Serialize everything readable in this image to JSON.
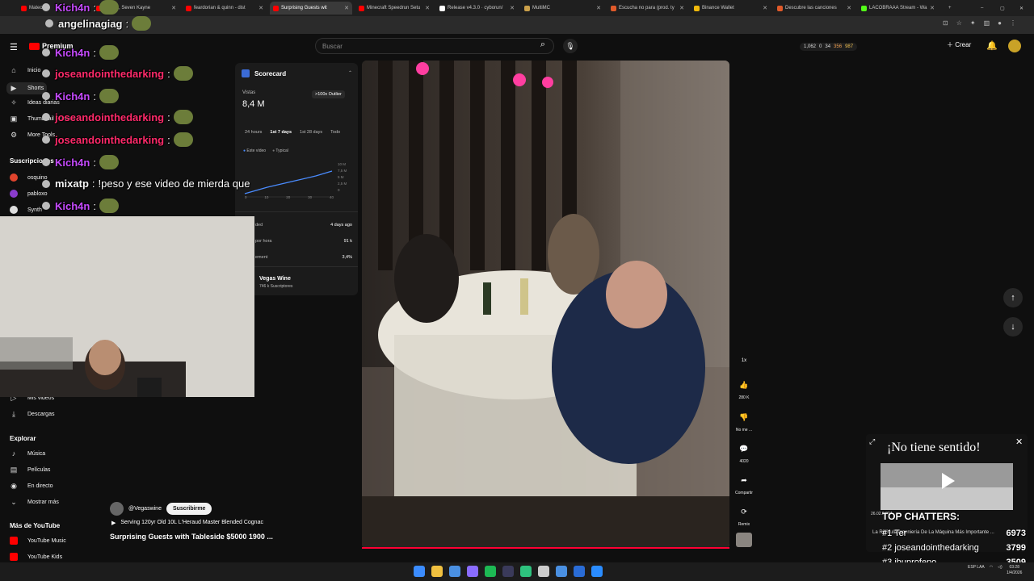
{
  "browser": {
    "tabs": [
      {
        "label": "Mateo",
        "color": "#ff0000"
      },
      {
        "label": "Kiske2, Seven Kayne",
        "color": "#ff0000"
      },
      {
        "label": "feardorian & quinn - dist",
        "color": "#ff0000"
      },
      {
        "label": "Surprising Guests wit",
        "color": "#ff0000",
        "active": true
      },
      {
        "label": "Minecraft Speedrun Setu",
        "color": "#ff0000"
      },
      {
        "label": "Release v4.3.0 · cyborun/",
        "color": "#ffffff"
      },
      {
        "label": "MultiMC",
        "color": "#caa04a"
      },
      {
        "label": "Escucha no para (prod. ty",
        "color": "#e05a2a"
      },
      {
        "label": "Binance Wallet",
        "color": "#f0b90b"
      },
      {
        "label": "Descubre las canciones",
        "color": "#e05a2a"
      },
      {
        "label": "LACOBRAAA Stream - Wa",
        "color": "#53fc18"
      }
    ],
    "new_tab": "+",
    "window_controls": [
      "–",
      "▢",
      "✕"
    ]
  },
  "header": {
    "logo_text": "Premium",
    "search_placeholder": "Buscar",
    "stats": [
      "1,062",
      "0",
      "34",
      "356",
      "987"
    ],
    "create_label": "Crear"
  },
  "sidebar": {
    "top_items": [
      {
        "label": "Inicio",
        "icon": "home-icon"
      },
      {
        "label": "Shorts",
        "icon": "shorts-icon"
      },
      {
        "label": "Ideas diarias",
        "icon": "ideas-icon"
      },
      {
        "label": "Thumbnail Preview",
        "icon": "thumbnail-icon"
      },
      {
        "label": "More Tools",
        "icon": "tools-icon"
      }
    ],
    "subscriptions_heading": "Suscripciones",
    "subscriptions": [
      {
        "label": "osquino",
        "color": "#e0442d"
      },
      {
        "label": "pabloxo",
        "color": "#8a3ccc"
      },
      {
        "label": "Synth",
        "color": "#dddddd"
      }
    ],
    "library_items": [
      {
        "label": "Mis videos",
        "icon": "videos-icon"
      },
      {
        "label": "Descargas",
        "icon": "download-icon"
      }
    ],
    "explore_heading": "Explorar",
    "explore_items": [
      {
        "label": "Música",
        "icon": "music-icon"
      },
      {
        "label": "Películas",
        "icon": "movies-icon"
      },
      {
        "label": "En directo",
        "icon": "live-icon"
      },
      {
        "label": "Mostrar más",
        "icon": "chevron-down-icon"
      }
    ],
    "more_heading": "Más de YouTube",
    "more_items": [
      {
        "label": "YouTube Music",
        "color": "#ff0000"
      },
      {
        "label": "YouTube Kids",
        "color": "#ff0000"
      }
    ]
  },
  "scorecard": {
    "title": "Scorecard",
    "views_label": "Vistas",
    "views_value": "8,4 M",
    "outlier_badge": ">100x Outlier",
    "ranges": [
      "24 hours",
      "1st 7 days",
      "1st 28 days",
      "Todo"
    ],
    "legend": [
      "Este vídeo",
      "Typical"
    ],
    "y_ticks": [
      "10 M",
      "7,5 M",
      "5 M",
      "2,5 M",
      "0"
    ],
    "x_ticks": [
      "0",
      "10",
      "20",
      "30",
      "40"
    ],
    "rows": [
      {
        "label": "ded",
        "value": "4 days ago"
      },
      {
        "label": "por hora",
        "value": "91 k"
      },
      {
        "label": "ement",
        "value": "3,4%"
      }
    ],
    "channel_name": "Vegas Wine",
    "channel_subs": "746 k Suscriptores"
  },
  "video": {
    "channel_handle": "@Vegaswine",
    "subscribe_label": "Suscribirme",
    "music_text": "Serving 120yr Old 10L L'Heraud Master Blended Cognac",
    "title": "Surprising Guests with Tableside $5000 1900 ...",
    "progress_percent": 100
  },
  "actions": [
    {
      "label": "",
      "icon": "speed-icon",
      "text": "1x"
    },
    {
      "label": "280 K",
      "icon": "like-icon"
    },
    {
      "label": "No me ...",
      "icon": "dislike-icon"
    },
    {
      "label": "4020",
      "icon": "comment-icon"
    },
    {
      "label": "Compartir",
      "icon": "share-icon"
    },
    {
      "label": "Remix",
      "icon": "remix-icon"
    }
  ],
  "chat": [
    {
      "user": "angelinagiag",
      "msg": "",
      "color": "white"
    },
    {
      "user": "Kich4n",
      "msg": "",
      "color": "purple"
    },
    {
      "user": "joseandointhedarking",
      "msg": "",
      "color": "pink"
    },
    {
      "user": "Kich4n",
      "msg": "",
      "color": "purple"
    },
    {
      "user": "joseandointhedarking",
      "msg": "",
      "color": "pink"
    },
    {
      "user": "joseandointhedarking",
      "msg": "",
      "color": "pink"
    },
    {
      "user": "Kich4n",
      "msg": "",
      "color": "purple"
    },
    {
      "user": "mixatp",
      "msg": "!peso y ese video de mierda que",
      "color": "white"
    },
    {
      "user": "Kich4n",
      "msg": "",
      "color": "purple"
    }
  ],
  "chat_top_user": "Kich4n",
  "overlay": {
    "title": "¡No tiene sentido!",
    "top_chatters_heading": "TOP CHATTERS:",
    "ticker": "La Ridícula Ingeniería De La Máquina Más Importante ...",
    "date_small": "26.02.9.024",
    "chatters": [
      {
        "rank": "#1",
        "name": "Ter",
        "score": "6973"
      },
      {
        "rank": "#2",
        "name": "joseandointhedarking",
        "score": "3799"
      },
      {
        "rank": "#3",
        "name": "ibuprofeno",
        "score": "3509"
      }
    ]
  },
  "taskbar": {
    "lang": "ESP LAA",
    "time": "03:28",
    "date": "1/4/2026"
  }
}
